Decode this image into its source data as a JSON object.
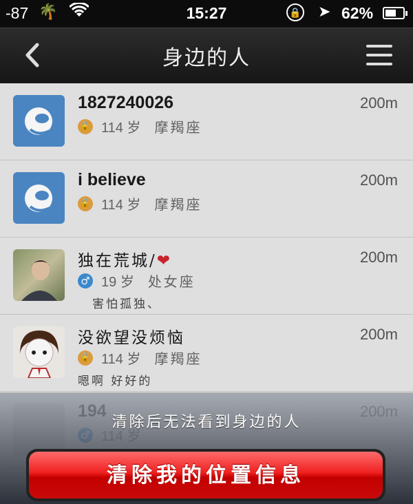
{
  "status": {
    "signal": "-87",
    "time": "15:27",
    "battery": "62%",
    "battery_level": 0.62
  },
  "nav": {
    "title": "身边的人"
  },
  "people": [
    {
      "name": "1827240026",
      "age": "114",
      "age_unit": "岁",
      "zodiac": "摩羯座",
      "distance": "200m",
      "gender": "lock",
      "signature": ""
    },
    {
      "name": "i believe",
      "age": "114",
      "age_unit": "岁",
      "zodiac": "摩羯座",
      "distance": "200m",
      "gender": "lock",
      "signature": ""
    },
    {
      "name": "独在荒城/",
      "name_suffix": "❤",
      "age": "19",
      "age_unit": "岁",
      "zodiac": "处女座",
      "distance": "200m",
      "gender": "male",
      "signature": "害怕孤独、"
    },
    {
      "name": "没欲望没烦恼",
      "age": "114",
      "age_unit": "岁",
      "zodiac": "摩羯座",
      "distance": "200m",
      "gender": "lock",
      "signature": "嗯啊 好好的"
    },
    {
      "name": "194",
      "age": "114",
      "age_unit": "岁",
      "zodiac": "",
      "distance": "200m",
      "gender": "male",
      "signature": ""
    }
  ],
  "sheet": {
    "message": "清除后无法看到身边的人",
    "button": "清除我的位置信息"
  }
}
